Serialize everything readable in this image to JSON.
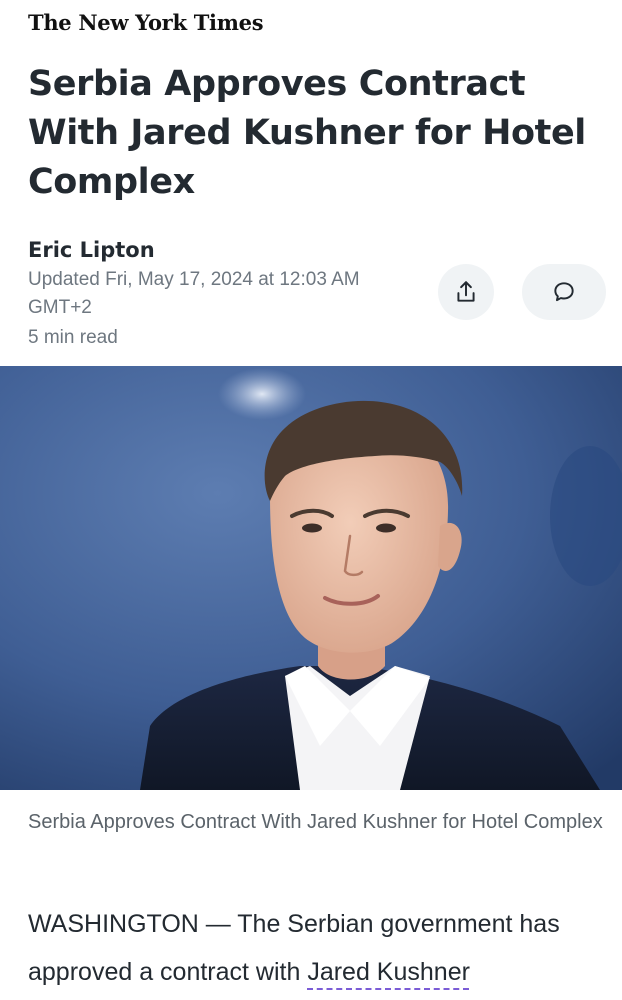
{
  "masthead": {
    "title": "The New York Times"
  },
  "article": {
    "headline": "Serbia Approves Contract With Jared Kushner for Hotel Complex",
    "author": "Eric Lipton",
    "updated": "Updated Fri, May 17, 2024 at 12:03 AM GMT+2",
    "read_time": "5 min read",
    "caption": "Serbia Approves Contract With Jared Kushner for Hotel Complex",
    "body_lead": "WASHINGTON — The Serbian government has approved a contract with ",
    "body_link": "Jared Kushner"
  },
  "actions": [
    {
      "icon": "share-icon"
    },
    {
      "icon": "comment-icon"
    }
  ],
  "colors": {
    "headline": "#232a31",
    "meta": "#6e7780",
    "action_bg": "#f0f3f5",
    "link_underline": "#7b5cd6"
  }
}
